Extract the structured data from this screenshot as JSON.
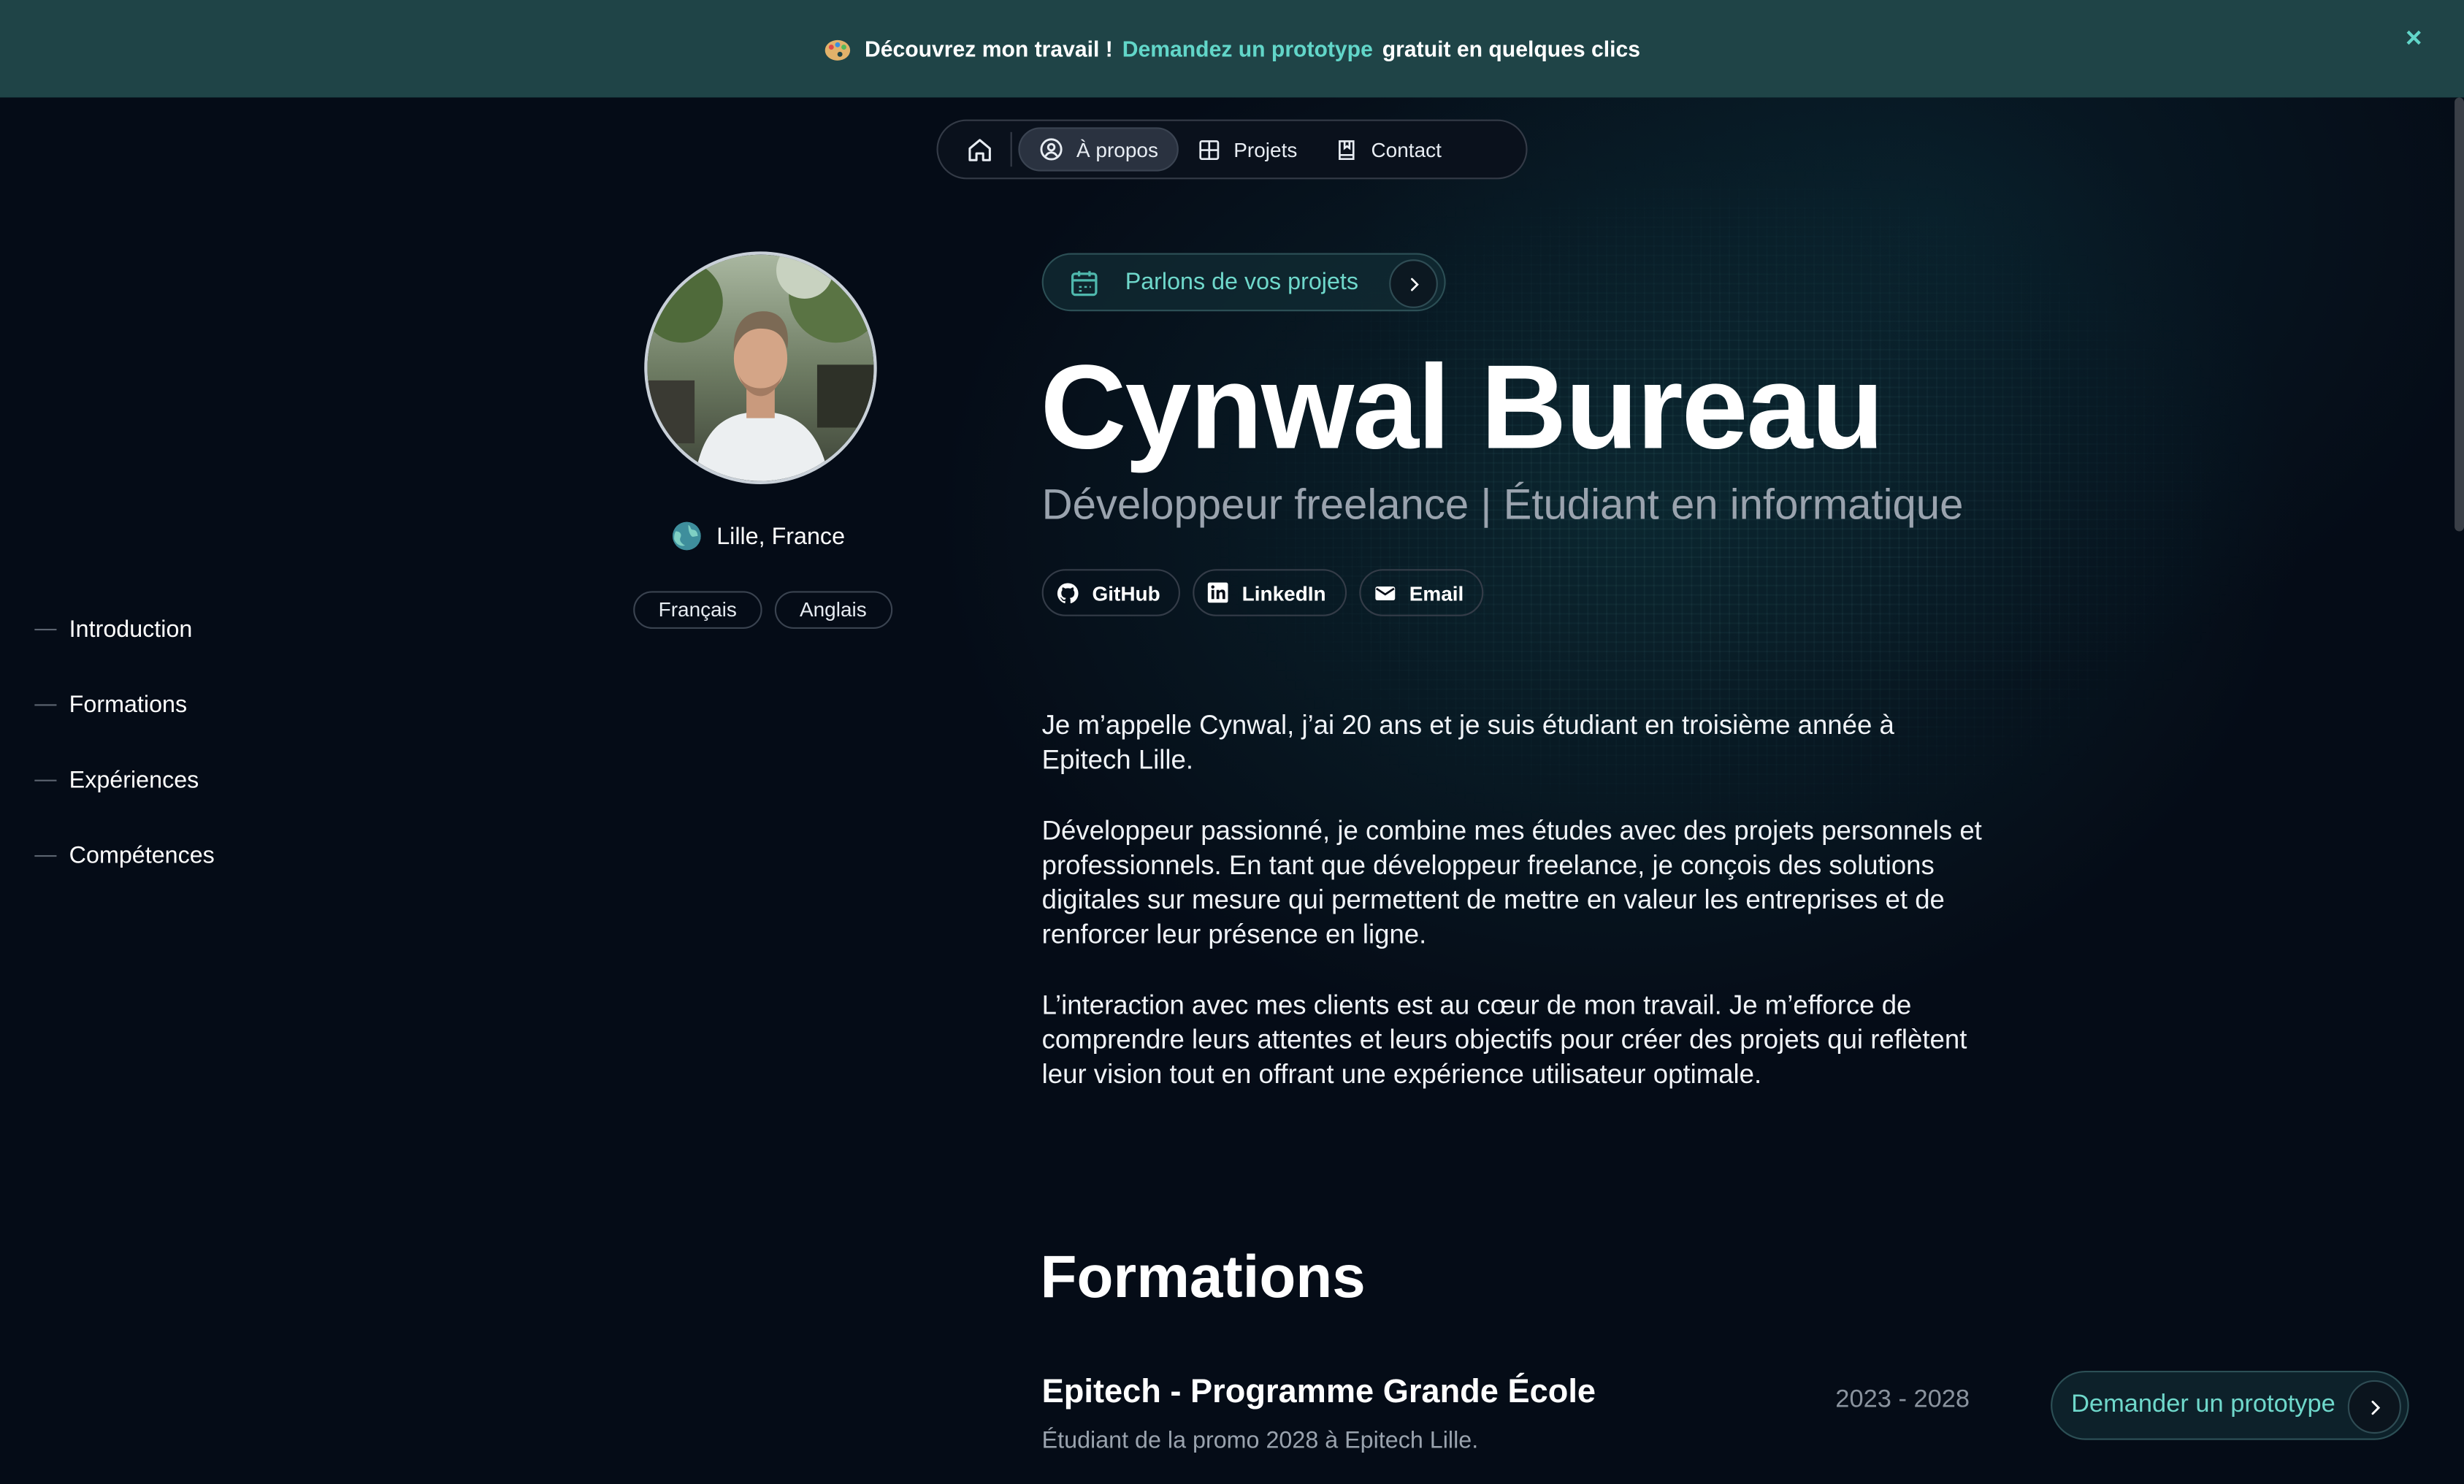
{
  "banner": {
    "text_before": "Découvrez mon travail !",
    "link": "Demandez un prototype",
    "text_after": "gratuit en quelques clics",
    "close": "×"
  },
  "nav": {
    "about": "À propos",
    "projects": "Projets",
    "contact": "Contact"
  },
  "sidebar": {
    "items": [
      {
        "label": "Introduction"
      },
      {
        "label": "Formations"
      },
      {
        "label": "Expériences"
      },
      {
        "label": "Compétences"
      }
    ]
  },
  "profile": {
    "location": "Lille, France",
    "languages": [
      "Français",
      "Anglais"
    ]
  },
  "hero": {
    "cta": "Parlons de vos projets",
    "name": "Cynwal Bureau",
    "subtitle": "Développeur freelance | Étudiant en informatique",
    "socials": [
      "GitHub",
      "LinkedIn",
      "Email"
    ]
  },
  "bio": [
    "Je m’appelle Cynwal, j’ai 20 ans et je suis étudiant en troisième année à Epitech Lille.",
    "Développeur passionné, je combine mes études avec des projets personnels et professionnels. En tant que développeur freelance, je conçois des solutions digitales sur mesure qui permettent de mettre en valeur les entreprises et de renforcer leur présence en ligne.",
    "L’interaction avec mes clients est au cœur de mon travail. Je m’efforce de comprendre leurs attentes et leurs objectifs pour créer des projets qui reflètent leur vision tout en offrant une expérience utilisateur optimale."
  ],
  "formations": {
    "title": "Formations",
    "items": [
      {
        "title": "Epitech - Programme Grande École",
        "dates": "2023 - 2028",
        "description": "Étudiant de la promo 2028 à Epitech Lille."
      }
    ]
  },
  "floating_cta": "Demander un prototype",
  "colors": {
    "accent": "#62d6c9",
    "banner_bg": "#1f4447",
    "page_bg": "#050c17"
  }
}
